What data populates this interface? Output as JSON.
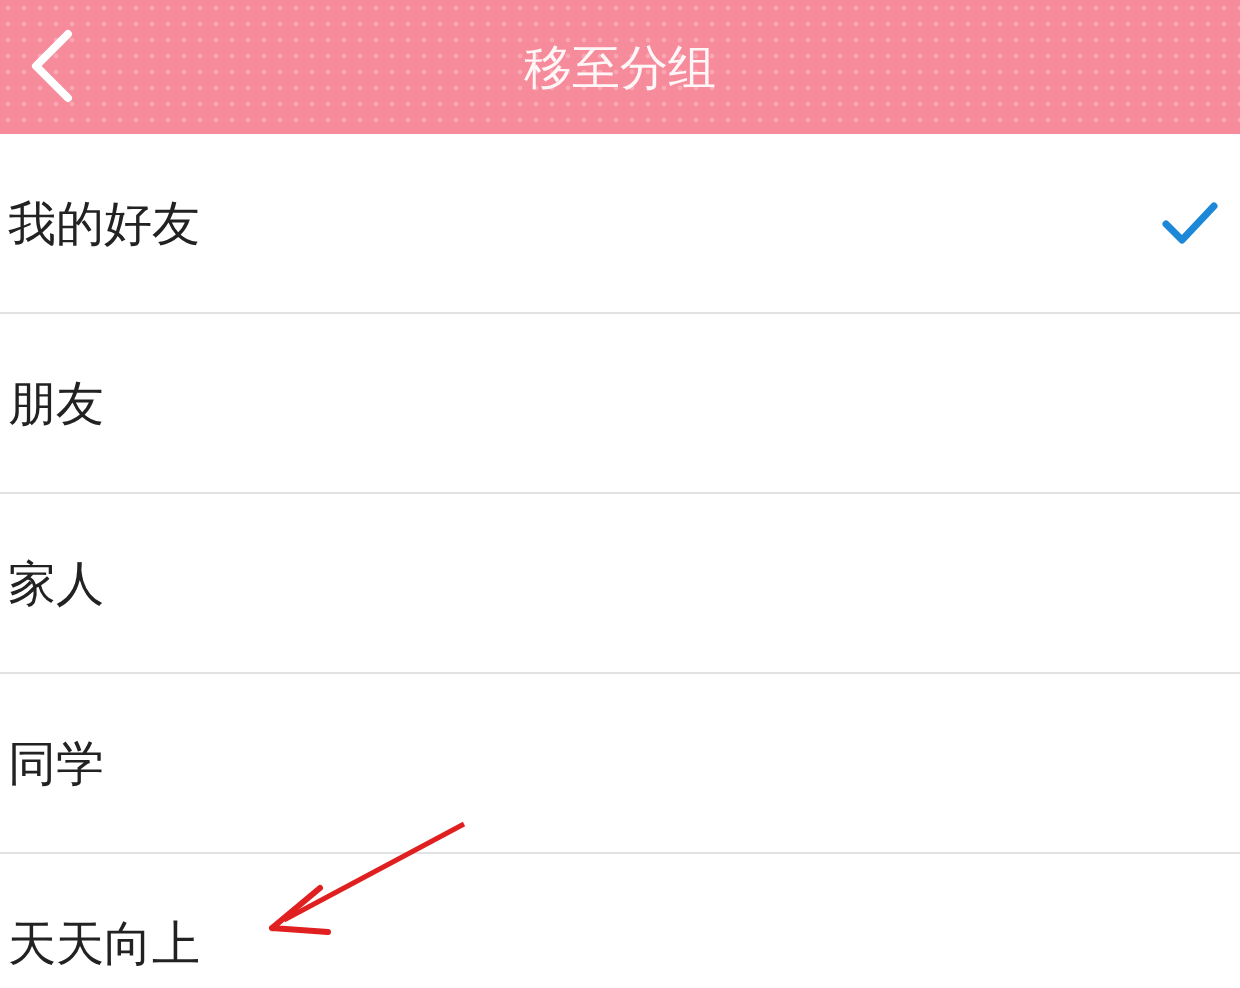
{
  "header": {
    "title": "移至分组"
  },
  "groups": [
    {
      "label": "我的好友",
      "selected": true
    },
    {
      "label": "朋友",
      "selected": false
    },
    {
      "label": "家人",
      "selected": false
    },
    {
      "label": "同学",
      "selected": false
    },
    {
      "label": "天天向上",
      "selected": false
    }
  ]
}
